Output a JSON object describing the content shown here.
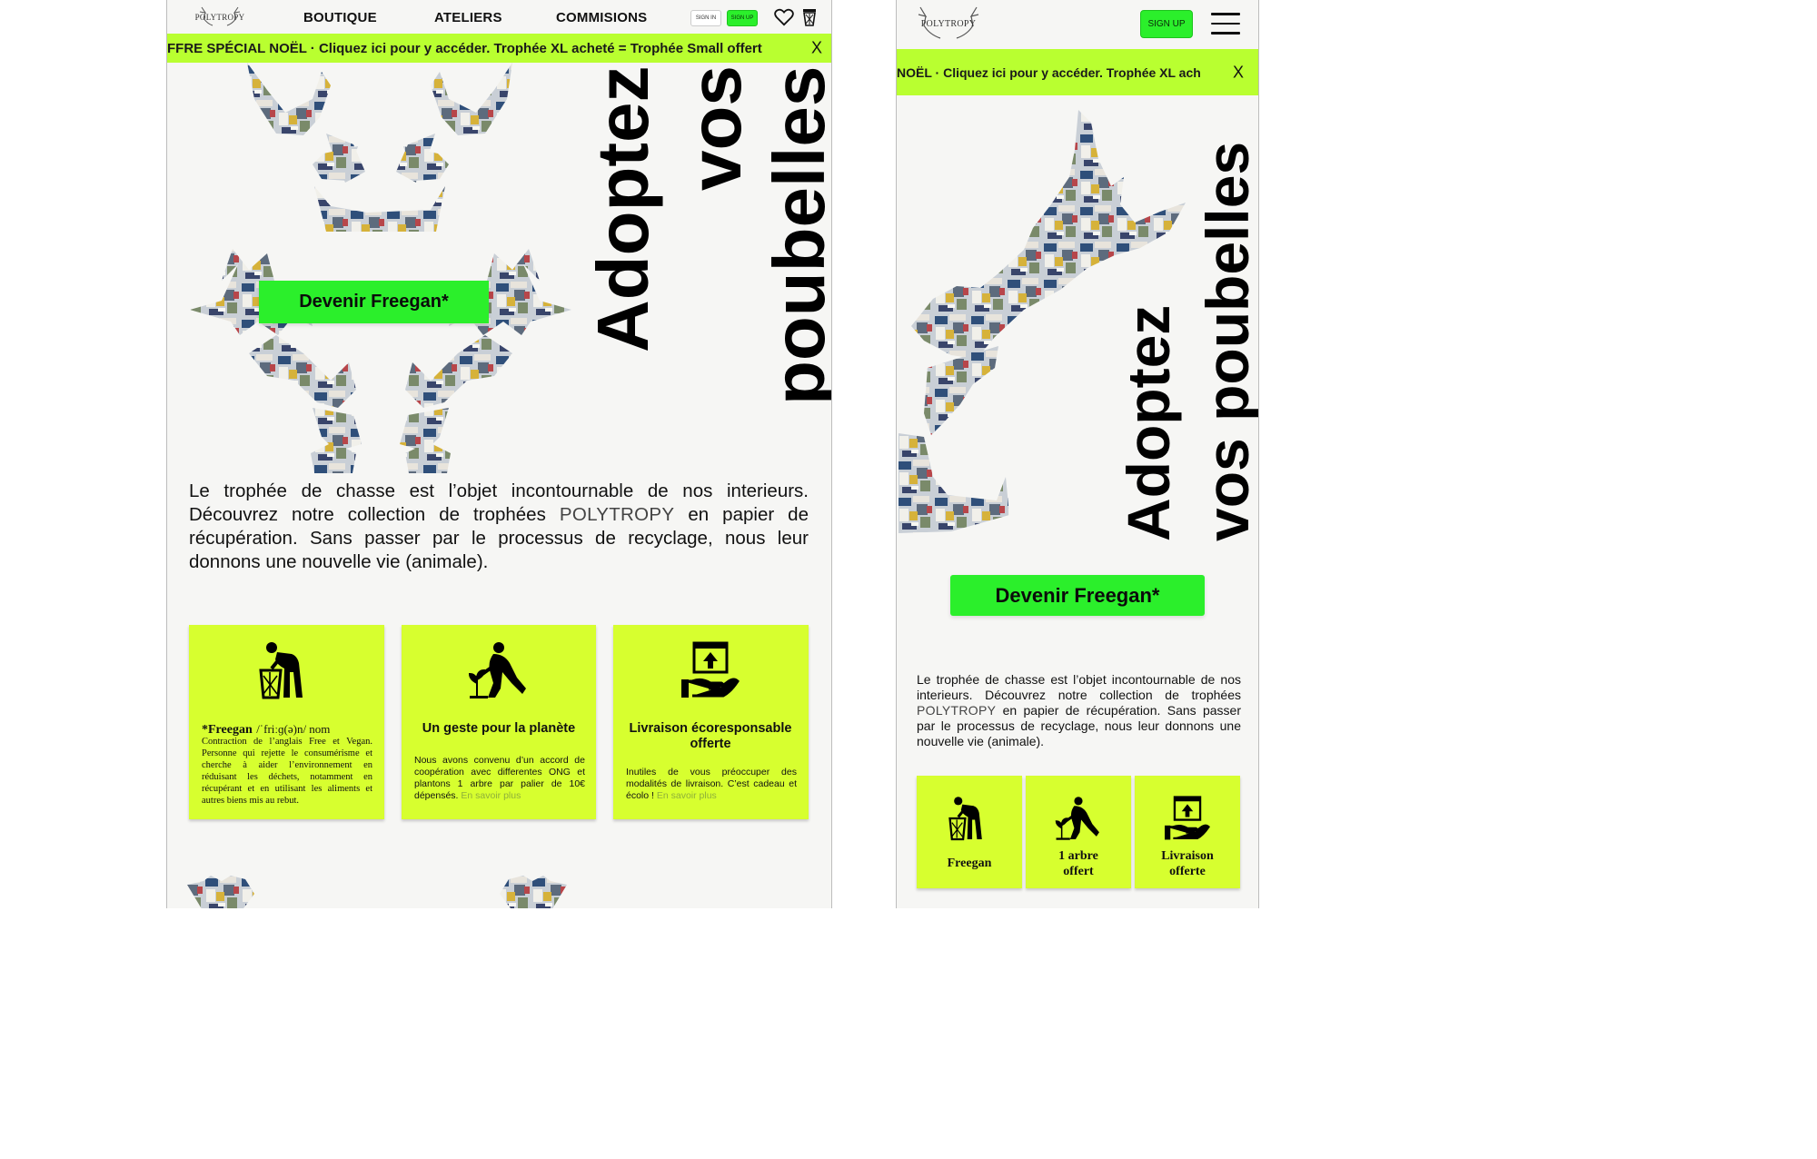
{
  "brand": "POLYTROPY",
  "colors": {
    "neon_green": "#2bef2b",
    "lime": "#d7ff2f",
    "banner": "#b9ff30",
    "link_muted": "#8fb03a"
  },
  "desktop": {
    "nav": {
      "boutique": "BOUTIQUE",
      "ateliers": "ATELIERS",
      "commisions": "COMMISIONS"
    },
    "sign_in": "SIGN IN",
    "sign_up": "SIGN UP",
    "icons": [
      "heart-icon",
      "trash-bin-icon"
    ],
    "banner_text": "FFRE SPÉCIAL NOËL · Cliquez ici pour y accéder. Trophée XL acheté = Trophée Small offert",
    "banner_close": "X",
    "hero_lines": [
      "Adoptez",
      "vos",
      "poubelles"
    ],
    "cta": "Devenir Freegan*",
    "intro": {
      "before": "Le trophée de chasse est l’objet incontournable de nos interieurs. Découvrez notre collection de trophées ",
      "brand": "POLYTROPY",
      "after": " en papier de récupération. Sans passer par le processus de recyclage, nous leur donnons une nouvelle vie (animale)."
    },
    "cards": [
      {
        "icon": "person-trash-icon",
        "word": "*Freegan",
        "phonetic": "/ˈfriːɡ(ə)n/ nom",
        "body": "Contraction de l’anglais Free et Vegan. Personne qui rejette le consumérisme et cherche à aider l’environnement en réduisant les déchets, notamment en récupérant et en utilisant les aliments et autres biens mis au rebut."
      },
      {
        "icon": "person-planting-icon",
        "title": "Un geste pour la planète",
        "body": "Nous avons convenu d’un accord de coopération avec differentes ONG et plantons 1 arbre par palier de 10€ dépensés.",
        "more": "En savoir plus"
      },
      {
        "icon": "hand-box-icon",
        "title": "Livraison écoresponsable offerte",
        "body": "Inutiles de vous préoccuper des modalités de livraison. C’est cadeau et écolo !",
        "more": "En savoir plus"
      }
    ]
  },
  "mobile": {
    "sign_up": "SIGN UP",
    "banner_text": "NOËL · Cliquez ici pour y accéder. Trophée XL ach",
    "banner_close": "X",
    "hero_lines": [
      "Adoptez",
      "vos poubelles"
    ],
    "cta": "Devenir Freegan*",
    "intro": {
      "before": "Le trophée de chasse est l’objet incontournable de nos interieurs. Découvrez notre collection de trophées ",
      "brand": "POLYTROPY",
      "after": " en papier de récupération. Sans passer par le processus de recyclage, nous leur donnons une nouvelle vie (animale)."
    },
    "cards": [
      {
        "icon": "person-trash-icon",
        "title": "Freegan"
      },
      {
        "icon": "person-planting-icon",
        "title": "1 arbre offert"
      },
      {
        "icon": "hand-box-icon",
        "title": "Livraison offerte"
      }
    ]
  }
}
